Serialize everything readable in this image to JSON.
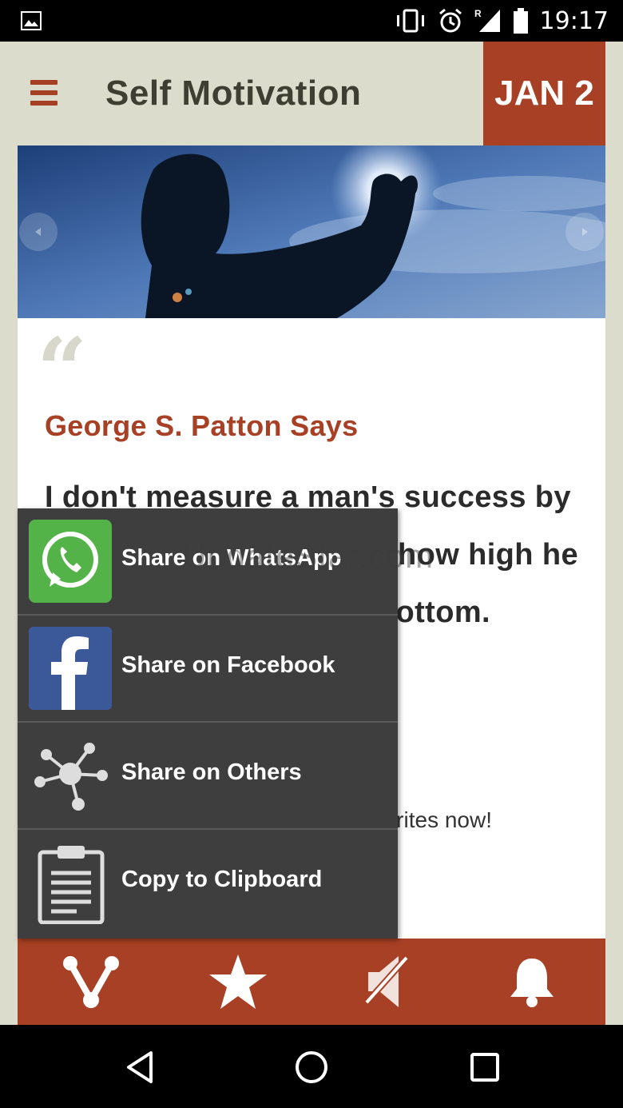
{
  "status_bar": {
    "time": "19:17",
    "icons": [
      "image-icon",
      "vibrate-icon",
      "alarm-icon",
      "signal-roaming-icon",
      "battery-icon"
    ]
  },
  "app": {
    "title": "Self Motivation",
    "date_badge": "JAN 2"
  },
  "quote": {
    "mark": "“",
    "author": "George S. Patton Says",
    "text": "I don't measure a man's success by how high he climbs but how high he bounces when he hits bottom.",
    "favorites_prompt": "Add to favourites now!"
  },
  "share_menu": {
    "items": [
      {
        "label": "Share on WhatsApp",
        "icon": "whatsapp-icon"
      },
      {
        "label": "Share on Facebook",
        "icon": "facebook-icon"
      },
      {
        "label": "Share on Others",
        "icon": "share-network-icon"
      },
      {
        "label": "Copy to Clipboard",
        "icon": "clipboard-icon"
      }
    ]
  },
  "watermark": "UpdateStar.com",
  "bottom_bar": [
    "share-icon",
    "star-icon",
    "mute-icon",
    "bell-icon"
  ],
  "colors": {
    "accent": "#a74024",
    "background": "#dcdccd",
    "menu_bg": "#3e3e3e"
  }
}
